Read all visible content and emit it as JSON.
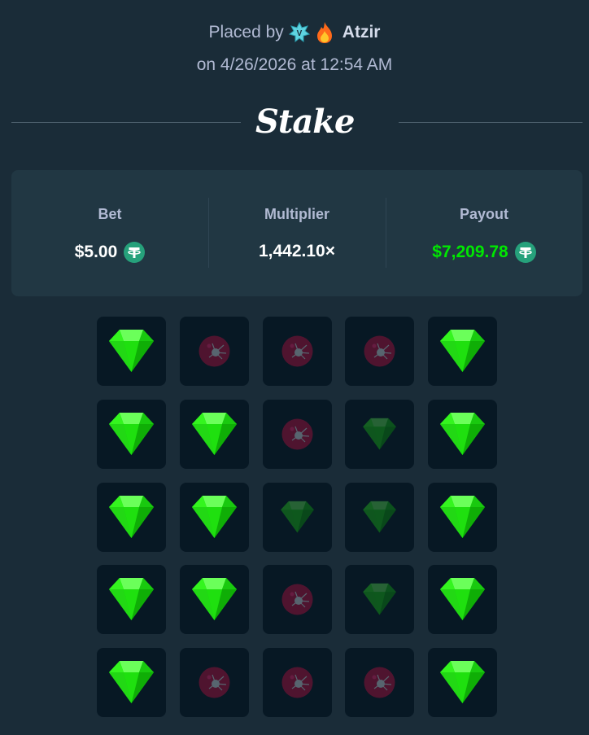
{
  "header": {
    "placed_by_label": "Placed by",
    "username": "Atzir",
    "vip_badge_icon": "vip-star-badge-icon",
    "fire_icon": "fire-icon",
    "date_line": "on 4/26/2026 at 12:54 AM"
  },
  "brand": {
    "logo_text": "Stake"
  },
  "stats": {
    "bet_label": "Bet",
    "bet_value": "$5.00",
    "multiplier_label": "Multiplier",
    "multiplier_value": "1,442.10×",
    "payout_label": "Payout",
    "payout_value": "$7,209.78",
    "currency_icon": "tether-usdt-coin-icon"
  },
  "colors": {
    "background": "#1a2c38",
    "card": "#213743",
    "tile": "#071824",
    "gem": "#00e701",
    "payout": "#00e701",
    "mine": "#6b0f2c",
    "coin": "#26a17b"
  },
  "grid": {
    "rows": [
      [
        "gem",
        "mine",
        "mine_dim",
        "mine_dim",
        "gem"
      ],
      [
        "gem",
        "gem",
        "mine_dim",
        "gem_dim",
        "gem"
      ],
      [
        "gem",
        "gem",
        "gem_dim",
        "gem_dim",
        "gem"
      ],
      [
        "gem",
        "gem",
        "mine_dim",
        "gem_dim",
        "gem"
      ],
      [
        "gem",
        "mine_dim",
        "mine_dim",
        "mine_dim",
        "gem"
      ]
    ]
  }
}
